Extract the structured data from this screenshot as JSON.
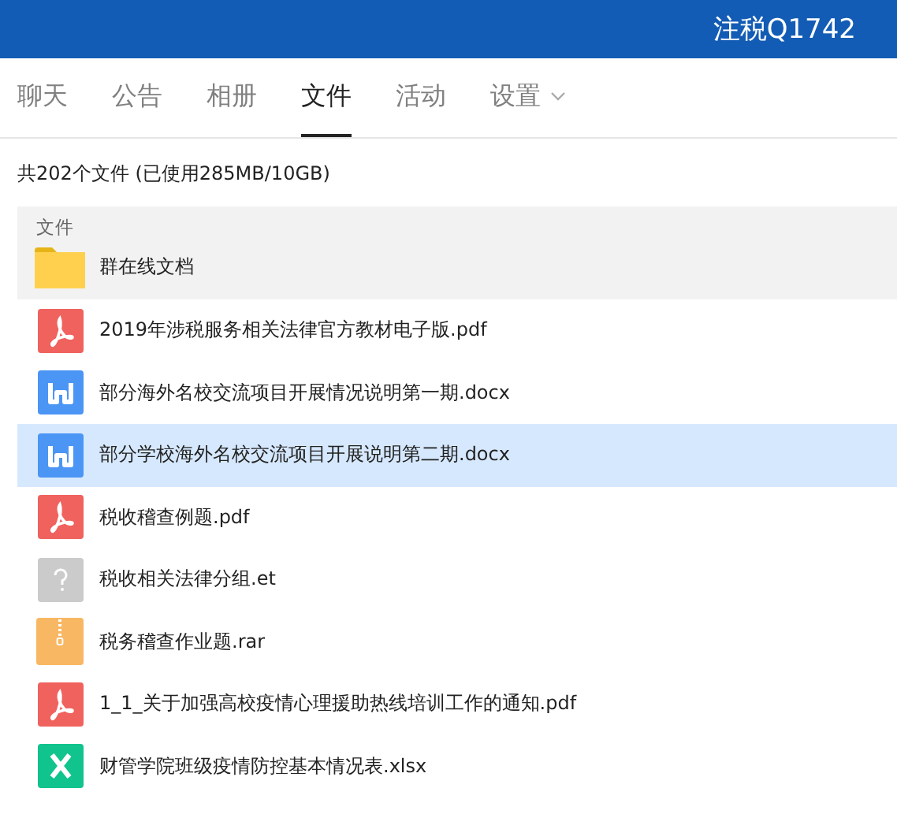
{
  "header": {
    "title": "注税Q1742"
  },
  "tabs": [
    {
      "label": "聊天",
      "selected": false,
      "has_menu": false
    },
    {
      "label": "公告",
      "selected": false,
      "has_menu": false
    },
    {
      "label": "相册",
      "selected": false,
      "has_menu": false
    },
    {
      "label": "文件",
      "selected": true,
      "has_menu": false
    },
    {
      "label": "活动",
      "selected": false,
      "has_menu": false
    },
    {
      "label": "设置",
      "selected": false,
      "has_menu": true
    }
  ],
  "summary": "共202个文件 (已使用285MB/10GB)",
  "folder_section": {
    "heading": "文件",
    "folders": [
      {
        "name": "群在线文档",
        "kind": "folder"
      }
    ]
  },
  "files": [
    {
      "name": "2019年涉税服务相关法律官方教材电子版.pdf",
      "kind": "pdf",
      "selected": false
    },
    {
      "name": "部分海外名校交流项目开展情况说明第一期.docx",
      "kind": "word",
      "selected": false
    },
    {
      "name": "部分学校海外名校交流项目开展说明第二期.docx",
      "kind": "word",
      "selected": true
    },
    {
      "name": "税收稽查例题.pdf",
      "kind": "pdf",
      "selected": false
    },
    {
      "name": "税收相关法律分组.et",
      "kind": "unknown",
      "selected": false
    },
    {
      "name": "税务稽查作业题.rar",
      "kind": "archive",
      "selected": false
    },
    {
      "name": "1_1_关于加强高校疫情心理援助热线培训工作的通知.pdf",
      "kind": "pdf",
      "selected": false
    },
    {
      "name": "财管学院班级疫情防控基本情况表.xlsx",
      "kind": "excel",
      "selected": false
    }
  ]
}
